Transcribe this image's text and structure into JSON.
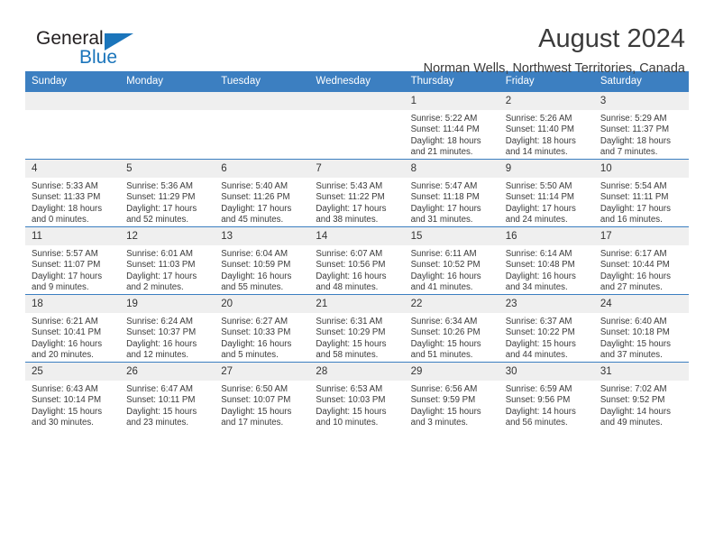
{
  "logo": {
    "word_one": "General",
    "word_two": "Blue",
    "triangle": "blue-triangle",
    "accent_color": "#1b75bb"
  },
  "header": {
    "title": "August 2024",
    "subtitle": "Norman Wells, Northwest Territories, Canada"
  },
  "calendar": {
    "header_color": "#3c7fc1",
    "daynum_bg": "#efefef",
    "weekday_headers": [
      "Sunday",
      "Monday",
      "Tuesday",
      "Wednesday",
      "Thursday",
      "Friday",
      "Saturday"
    ],
    "weeks": [
      [
        {
          "day": "",
          "sunrise": "",
          "sunset": "",
          "daylight_1": "",
          "daylight_2": ""
        },
        {
          "day": "",
          "sunrise": "",
          "sunset": "",
          "daylight_1": "",
          "daylight_2": ""
        },
        {
          "day": "",
          "sunrise": "",
          "sunset": "",
          "daylight_1": "",
          "daylight_2": ""
        },
        {
          "day": "",
          "sunrise": "",
          "sunset": "",
          "daylight_1": "",
          "daylight_2": ""
        },
        {
          "day": "1",
          "sunrise": "Sunrise: 5:22 AM",
          "sunset": "Sunset: 11:44 PM",
          "daylight_1": "Daylight: 18 hours",
          "daylight_2": "and 21 minutes."
        },
        {
          "day": "2",
          "sunrise": "Sunrise: 5:26 AM",
          "sunset": "Sunset: 11:40 PM",
          "daylight_1": "Daylight: 18 hours",
          "daylight_2": "and 14 minutes."
        },
        {
          "day": "3",
          "sunrise": "Sunrise: 5:29 AM",
          "sunset": "Sunset: 11:37 PM",
          "daylight_1": "Daylight: 18 hours",
          "daylight_2": "and 7 minutes."
        }
      ],
      [
        {
          "day": "4",
          "sunrise": "Sunrise: 5:33 AM",
          "sunset": "Sunset: 11:33 PM",
          "daylight_1": "Daylight: 18 hours",
          "daylight_2": "and 0 minutes."
        },
        {
          "day": "5",
          "sunrise": "Sunrise: 5:36 AM",
          "sunset": "Sunset: 11:29 PM",
          "daylight_1": "Daylight: 17 hours",
          "daylight_2": "and 52 minutes."
        },
        {
          "day": "6",
          "sunrise": "Sunrise: 5:40 AM",
          "sunset": "Sunset: 11:26 PM",
          "daylight_1": "Daylight: 17 hours",
          "daylight_2": "and 45 minutes."
        },
        {
          "day": "7",
          "sunrise": "Sunrise: 5:43 AM",
          "sunset": "Sunset: 11:22 PM",
          "daylight_1": "Daylight: 17 hours",
          "daylight_2": "and 38 minutes."
        },
        {
          "day": "8",
          "sunrise": "Sunrise: 5:47 AM",
          "sunset": "Sunset: 11:18 PM",
          "daylight_1": "Daylight: 17 hours",
          "daylight_2": "and 31 minutes."
        },
        {
          "day": "9",
          "sunrise": "Sunrise: 5:50 AM",
          "sunset": "Sunset: 11:14 PM",
          "daylight_1": "Daylight: 17 hours",
          "daylight_2": "and 24 minutes."
        },
        {
          "day": "10",
          "sunrise": "Sunrise: 5:54 AM",
          "sunset": "Sunset: 11:11 PM",
          "daylight_1": "Daylight: 17 hours",
          "daylight_2": "and 16 minutes."
        }
      ],
      [
        {
          "day": "11",
          "sunrise": "Sunrise: 5:57 AM",
          "sunset": "Sunset: 11:07 PM",
          "daylight_1": "Daylight: 17 hours",
          "daylight_2": "and 9 minutes."
        },
        {
          "day": "12",
          "sunrise": "Sunrise: 6:01 AM",
          "sunset": "Sunset: 11:03 PM",
          "daylight_1": "Daylight: 17 hours",
          "daylight_2": "and 2 minutes."
        },
        {
          "day": "13",
          "sunrise": "Sunrise: 6:04 AM",
          "sunset": "Sunset: 10:59 PM",
          "daylight_1": "Daylight: 16 hours",
          "daylight_2": "and 55 minutes."
        },
        {
          "day": "14",
          "sunrise": "Sunrise: 6:07 AM",
          "sunset": "Sunset: 10:56 PM",
          "daylight_1": "Daylight: 16 hours",
          "daylight_2": "and 48 minutes."
        },
        {
          "day": "15",
          "sunrise": "Sunrise: 6:11 AM",
          "sunset": "Sunset: 10:52 PM",
          "daylight_1": "Daylight: 16 hours",
          "daylight_2": "and 41 minutes."
        },
        {
          "day": "16",
          "sunrise": "Sunrise: 6:14 AM",
          "sunset": "Sunset: 10:48 PM",
          "daylight_1": "Daylight: 16 hours",
          "daylight_2": "and 34 minutes."
        },
        {
          "day": "17",
          "sunrise": "Sunrise: 6:17 AM",
          "sunset": "Sunset: 10:44 PM",
          "daylight_1": "Daylight: 16 hours",
          "daylight_2": "and 27 minutes."
        }
      ],
      [
        {
          "day": "18",
          "sunrise": "Sunrise: 6:21 AM",
          "sunset": "Sunset: 10:41 PM",
          "daylight_1": "Daylight: 16 hours",
          "daylight_2": "and 20 minutes."
        },
        {
          "day": "19",
          "sunrise": "Sunrise: 6:24 AM",
          "sunset": "Sunset: 10:37 PM",
          "daylight_1": "Daylight: 16 hours",
          "daylight_2": "and 12 minutes."
        },
        {
          "day": "20",
          "sunrise": "Sunrise: 6:27 AM",
          "sunset": "Sunset: 10:33 PM",
          "daylight_1": "Daylight: 16 hours",
          "daylight_2": "and 5 minutes."
        },
        {
          "day": "21",
          "sunrise": "Sunrise: 6:31 AM",
          "sunset": "Sunset: 10:29 PM",
          "daylight_1": "Daylight: 15 hours",
          "daylight_2": "and 58 minutes."
        },
        {
          "day": "22",
          "sunrise": "Sunrise: 6:34 AM",
          "sunset": "Sunset: 10:26 PM",
          "daylight_1": "Daylight: 15 hours",
          "daylight_2": "and 51 minutes."
        },
        {
          "day": "23",
          "sunrise": "Sunrise: 6:37 AM",
          "sunset": "Sunset: 10:22 PM",
          "daylight_1": "Daylight: 15 hours",
          "daylight_2": "and 44 minutes."
        },
        {
          "day": "24",
          "sunrise": "Sunrise: 6:40 AM",
          "sunset": "Sunset: 10:18 PM",
          "daylight_1": "Daylight: 15 hours",
          "daylight_2": "and 37 minutes."
        }
      ],
      [
        {
          "day": "25",
          "sunrise": "Sunrise: 6:43 AM",
          "sunset": "Sunset: 10:14 PM",
          "daylight_1": "Daylight: 15 hours",
          "daylight_2": "and 30 minutes."
        },
        {
          "day": "26",
          "sunrise": "Sunrise: 6:47 AM",
          "sunset": "Sunset: 10:11 PM",
          "daylight_1": "Daylight: 15 hours",
          "daylight_2": "and 23 minutes."
        },
        {
          "day": "27",
          "sunrise": "Sunrise: 6:50 AM",
          "sunset": "Sunset: 10:07 PM",
          "daylight_1": "Daylight: 15 hours",
          "daylight_2": "and 17 minutes."
        },
        {
          "day": "28",
          "sunrise": "Sunrise: 6:53 AM",
          "sunset": "Sunset: 10:03 PM",
          "daylight_1": "Daylight: 15 hours",
          "daylight_2": "and 10 minutes."
        },
        {
          "day": "29",
          "sunrise": "Sunrise: 6:56 AM",
          "sunset": "Sunset: 9:59 PM",
          "daylight_1": "Daylight: 15 hours",
          "daylight_2": "and 3 minutes."
        },
        {
          "day": "30",
          "sunrise": "Sunrise: 6:59 AM",
          "sunset": "Sunset: 9:56 PM",
          "daylight_1": "Daylight: 14 hours",
          "daylight_2": "and 56 minutes."
        },
        {
          "day": "31",
          "sunrise": "Sunrise: 7:02 AM",
          "sunset": "Sunset: 9:52 PM",
          "daylight_1": "Daylight: 14 hours",
          "daylight_2": "and 49 minutes."
        }
      ]
    ]
  }
}
